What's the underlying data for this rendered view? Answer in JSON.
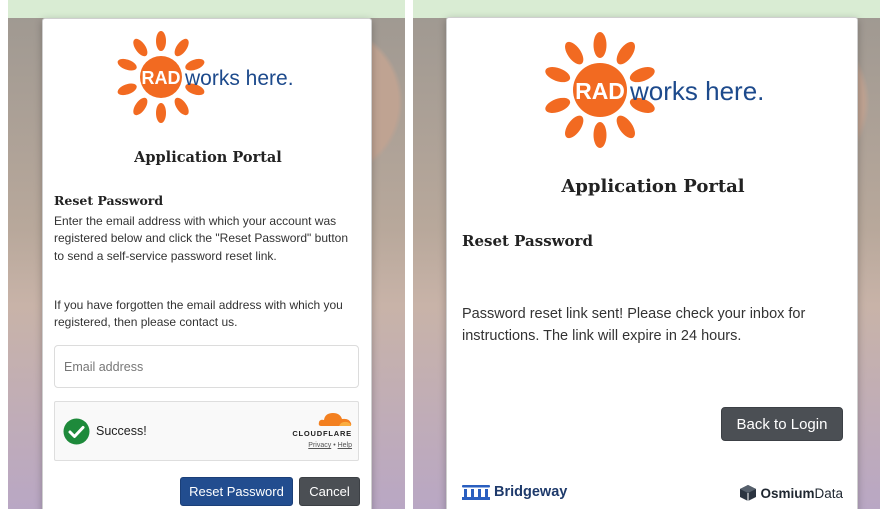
{
  "left": {
    "logo": {
      "badge": "RAD",
      "text": "works here."
    },
    "title": "Application Portal",
    "heading": "Reset Password",
    "paragraph1": "Enter the email address with which your account was registered below and click the \"Reset Password\" button to send a self-service password reset link.",
    "paragraph2": "If you have forgotten the email address with which you registered, then please contact us.",
    "email_placeholder": "Email address",
    "captcha": {
      "status": "Success!",
      "brand": "CLOUDFLARE",
      "privacy": "Privacy",
      "separator": "•",
      "help": "Help"
    },
    "reset_button": "Reset Password",
    "cancel_button": "Cancel"
  },
  "right": {
    "logo": {
      "badge": "RAD",
      "text": "works here."
    },
    "title": "Application Portal",
    "heading": "Reset Password",
    "message": "Password reset link sent! Please check your inbox for instructions. The link will expire in 24 hours.",
    "back_button": "Back to Login",
    "footer": {
      "left": "Bridgeway",
      "right_bold": "Osmium",
      "right_normal": "Data"
    }
  },
  "colors": {
    "orange": "#f26a21",
    "navy": "#1d4a8c",
    "primary_button": "#224d8f",
    "secondary_button": "#4b4f54",
    "success_green": "#1e8a3b"
  }
}
